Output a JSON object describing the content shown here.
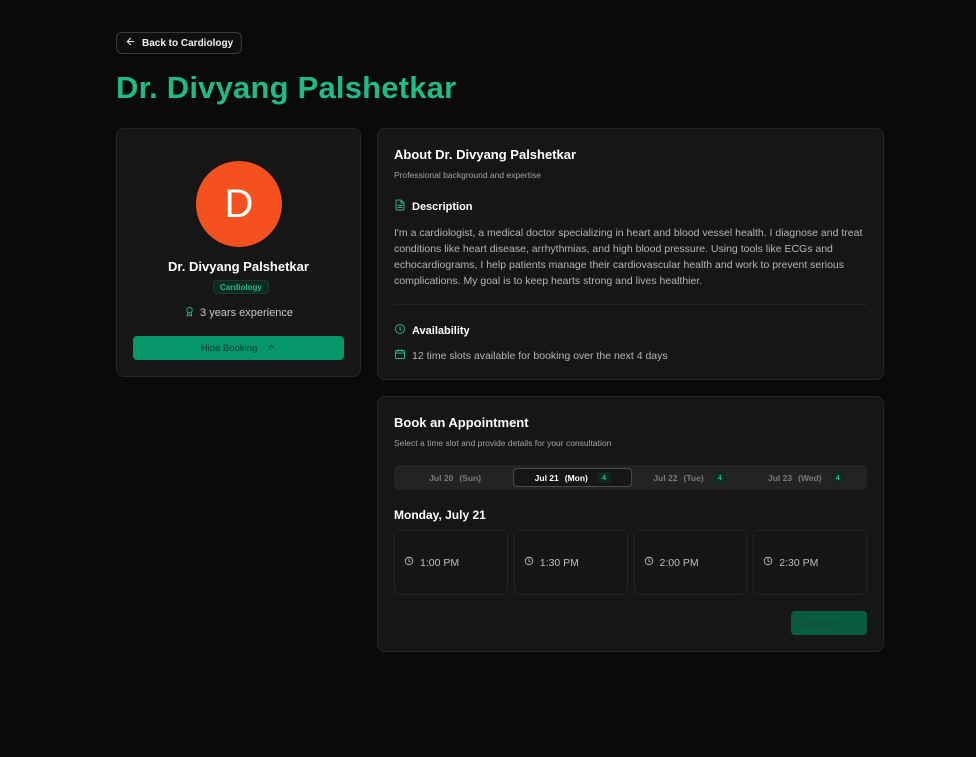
{
  "nav": {
    "back_label": "Back to Cardiology"
  },
  "page": {
    "title": "Dr. Divyang Palshetkar"
  },
  "profile": {
    "avatar_initial": "D",
    "avatar_color": "#f4511e",
    "name": "Dr. Divyang Palshetkar",
    "specialty": "Cardiology",
    "experience": "3 years experience",
    "hide_booking_label": "Hide Booking"
  },
  "about": {
    "title": "About Dr. Divyang Palshetkar",
    "subtitle": "Professional background and expertise",
    "description_heading": "Description",
    "description": "I'm a cardiologist, a medical doctor specializing in heart and blood vessel health. I diagnose and treat conditions like heart disease, arrhythmias, and high blood pressure. Using tools like ECGs and echocardiograms, I help patients manage their cardiovascular health and work to prevent serious complications. My goal is to keep hearts strong and lives healthier.",
    "availability_heading": "Availability",
    "availability_text": "12 time slots available for booking over the next 4 days"
  },
  "booking": {
    "title": "Book an Appointment",
    "subtitle": "Select a time slot and provide details for your consultation",
    "dates": [
      {
        "date": "Jul 20",
        "day": "(Sun)",
        "count": ""
      },
      {
        "date": "Jul 21",
        "day": "(Mon)",
        "count": "4"
      },
      {
        "date": "Jul 22",
        "day": "(Tue)",
        "count": "4"
      },
      {
        "date": "Jul 23",
        "day": "(Wed)",
        "count": "4"
      }
    ],
    "selected_day": "Monday, July 21",
    "slots": [
      "1:00 PM",
      "1:30 PM",
      "2:00 PM",
      "2:30 PM"
    ],
    "continue_label": "Continue"
  },
  "colors": {
    "accent": "#1fb98a",
    "primary_button": "#059669",
    "background": "#0a0a0a",
    "card": "#161616"
  }
}
